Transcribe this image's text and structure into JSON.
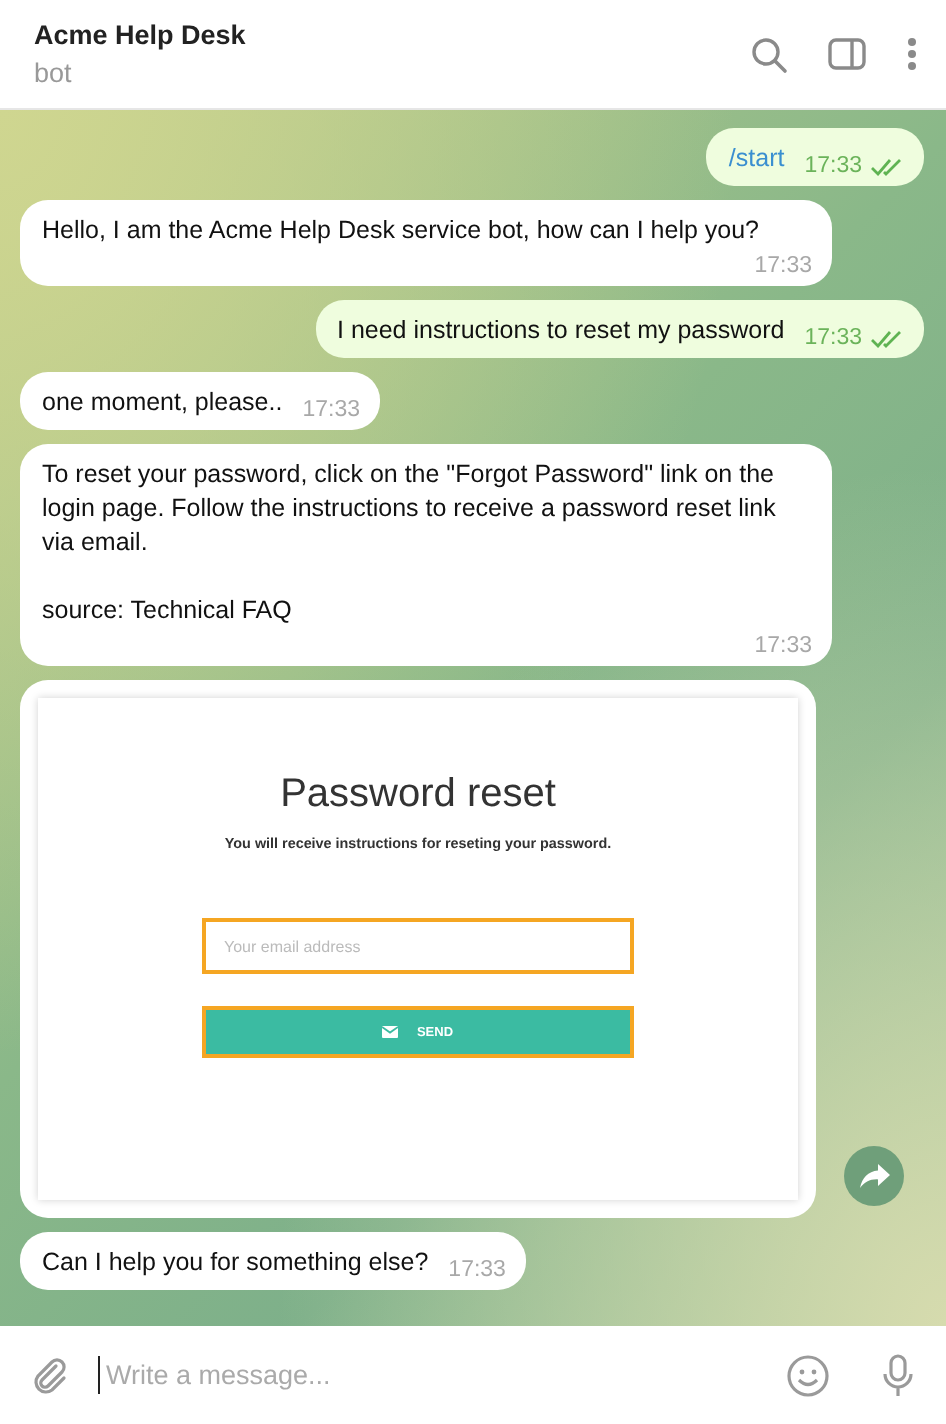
{
  "header": {
    "title": "Acme Help Desk",
    "subtitle": "bot"
  },
  "messages": [
    {
      "kind": "command",
      "outgoing": true,
      "text": "/start",
      "time": "17:33",
      "read": true
    },
    {
      "kind": "text",
      "outgoing": false,
      "text": "Hello, I am the Acme Help Desk service bot, how can I help you?",
      "time": "17:33"
    },
    {
      "kind": "text",
      "outgoing": true,
      "text": "I need instructions to reset my password",
      "time": "17:33",
      "read": true
    },
    {
      "kind": "text",
      "outgoing": false,
      "text": "one moment, please..",
      "time": "17:33"
    },
    {
      "kind": "paragraphs",
      "outgoing": false,
      "paragraphs": [
        "To reset your password, click on the \"Forgot Password\" link on the login page. Follow the instructions to receive a password reset link via email.",
        "source: Technical FAQ"
      ],
      "time": "17:33"
    },
    {
      "kind": "screenshot",
      "outgoing": false,
      "page": {
        "title": "Password reset",
        "subtitle": "You will receive instructions for reseting your password.",
        "email_placeholder": "Your email address",
        "button": "SEND"
      }
    },
    {
      "kind": "text",
      "outgoing": false,
      "text": "Can I help you for something else?",
      "time": "17:33"
    }
  ],
  "composer": {
    "placeholder": "Write a message..."
  }
}
